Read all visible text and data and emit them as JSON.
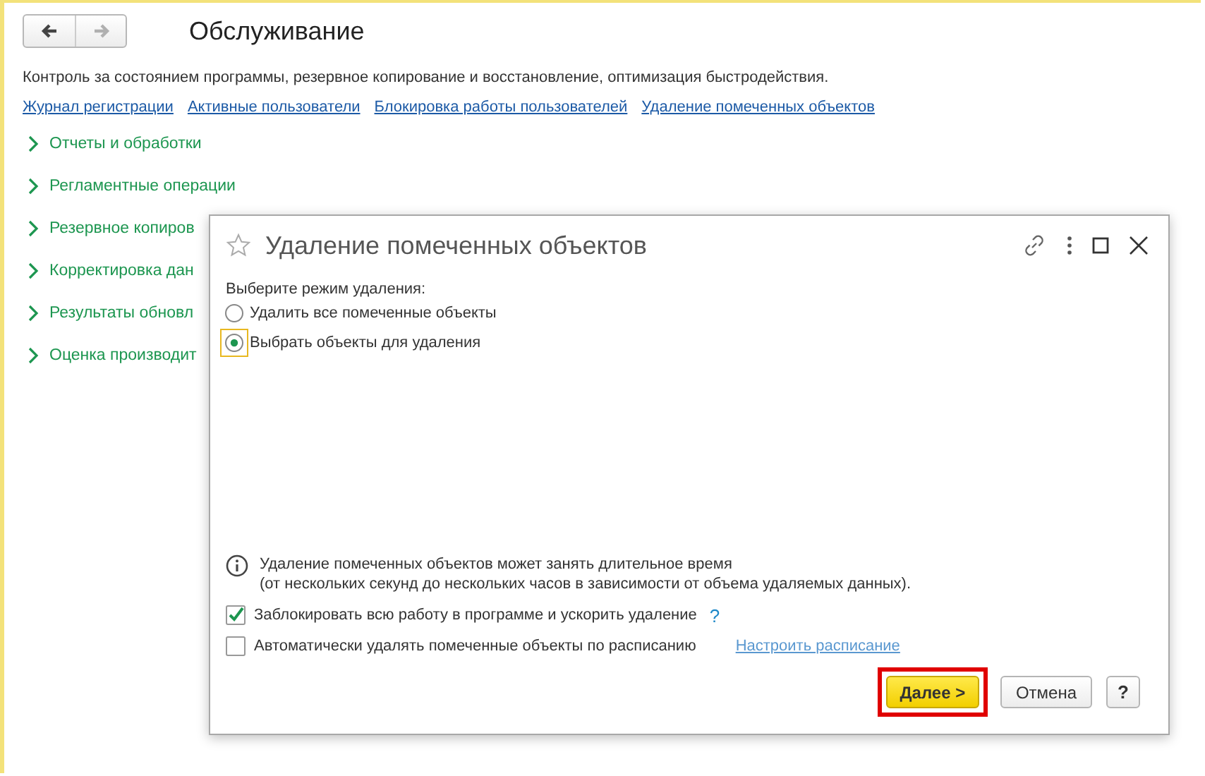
{
  "page": {
    "title": "Обслуживание",
    "nav": [
      {
        "kind": "back",
        "disabled": false
      },
      {
        "kind": "forward",
        "disabled": true
      }
    ],
    "description": "Контроль за состоянием программы, резервное копирование и восстановление, оптимизация быстродействия.",
    "links": [
      "Журнал регистрации",
      "Активные пользователи",
      "Блокировка работы пользователей",
      "Удаление помеченных объектов"
    ],
    "sections": [
      {
        "label": "Отчеты и обработки",
        "expanded": false
      },
      {
        "label": "Регламентные операции",
        "expanded": false
      },
      {
        "label": "Резервное копиров",
        "expanded": false
      },
      {
        "label": "Корректировка дан",
        "expanded": false
      },
      {
        "label": "Результаты обновл",
        "expanded": false
      },
      {
        "label": "Оценка производит",
        "expanded": false
      }
    ]
  },
  "dialog": {
    "title": "Удаление помеченных объектов",
    "favorite": false,
    "mode_label": "Выберите режим удаления:",
    "modes": [
      {
        "label": "Удалить все помеченные объекты",
        "selected": false,
        "focused": false
      },
      {
        "label": "Выбрать объекты для удаления",
        "selected": true,
        "focused": true
      }
    ],
    "info": [
      "Удаление помеченных объектов может занять длительное время",
      "(от нескольких секунд до нескольких часов в зависимости от объема удаляемых данных)."
    ],
    "options": [
      {
        "label": "Заблокировать всю работу в программе и ускорить удаление",
        "checked": true,
        "help": "?"
      },
      {
        "label": "Автоматически удалять помеченные объекты по расписанию",
        "checked": false,
        "link": "Настроить расписание"
      }
    ],
    "buttons": [
      {
        "label": "Далее >",
        "kind": "default",
        "highlighted": true
      },
      {
        "label": "Отмена",
        "kind": "normal",
        "highlighted": false
      },
      {
        "label": "?",
        "kind": "help",
        "highlighted": false
      }
    ]
  }
}
